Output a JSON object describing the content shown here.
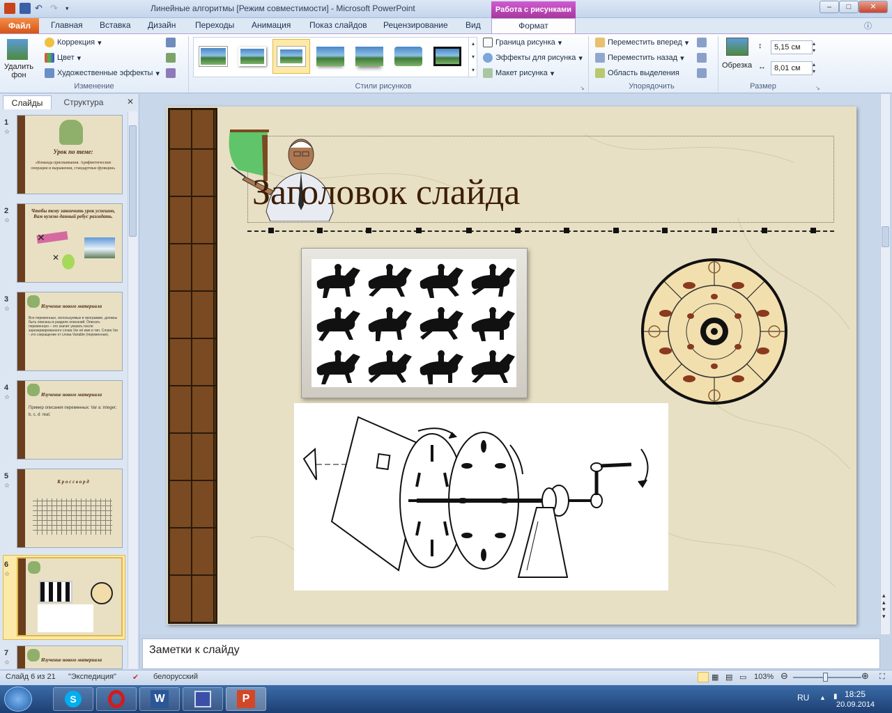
{
  "window": {
    "title": "Линейные алгоритмы [Режим совместимости]  -  Microsoft PowerPoint",
    "context_group": "Работа с рисунками",
    "controls": {
      "minimize": "–",
      "maximize": "□",
      "close": "✕"
    }
  },
  "tabs": {
    "file": "Файл",
    "items": [
      "Главная",
      "Вставка",
      "Дизайн",
      "Переходы",
      "Анимация",
      "Показ слайдов",
      "Рецензирование",
      "Вид"
    ],
    "active": "Формат"
  },
  "ribbon": {
    "remove_bg": {
      "line1": "Удалить",
      "line2": "фон"
    },
    "adjust": {
      "correction": "Коррекция",
      "color": "Цвет",
      "artistic": "Художественные эффекты",
      "label": "Изменение"
    },
    "styles": {
      "label": "Стили рисунков",
      "border": "Граница рисунка",
      "effects": "Эффекты для рисунка",
      "layout": "Макет рисунка"
    },
    "arrange": {
      "forward": "Переместить вперед",
      "backward": "Переместить назад",
      "selection": "Область выделения",
      "label": "Упорядочить"
    },
    "size": {
      "crop": "Обрезка",
      "height": "5,15 см",
      "width": "8,01 см",
      "label": "Размер"
    }
  },
  "left_panel": {
    "tab_slides": "Слайды",
    "tab_outline": "Структура",
    "close": "✕",
    "slides": [
      {
        "num": "1",
        "title": "Урок по теме:",
        "text": "«Команда присваивания. Арифметические операции и выражения, стандартные функции»"
      },
      {
        "num": "2",
        "title": "Чтобы тему закончить урок успешно, Вам нужно данный ребус разгадать.",
        "text": ""
      },
      {
        "num": "3",
        "title": "Изучение нового материала",
        "text": "Все переменные, используемые в программе, должны быть описаны в разделе описаний. Описать переменную – это значит указать после зарезервированного слова Var её имя и тип. Слово Var - это сокращение от слова Variable (переменная)."
      },
      {
        "num": "4",
        "title": "Изучение нового материала",
        "text": "Пример описания переменных: Var a: integer; b, c, d: real;"
      },
      {
        "num": "5",
        "title": "К р о с с в о р д",
        "text": ""
      },
      {
        "num": "6",
        "title": "",
        "text": ""
      },
      {
        "num": "7",
        "title": "Изучение нового материала",
        "text": ""
      }
    ]
  },
  "slide": {
    "title": "Заголовок слайда"
  },
  "notes": {
    "placeholder": "Заметки к слайду"
  },
  "status": {
    "slide_of": "Слайд 6 из 21",
    "theme": "\"Экспедиция\"",
    "language": "белорусский",
    "zoom": "103%"
  },
  "taskbar": {
    "lang": "RU",
    "time": "18:25",
    "date": "20.09.2014"
  },
  "colors": {
    "accent_file": "#d4541a",
    "context": "#a6379f",
    "slide_bg": "#e8e0c4",
    "title": "#3c1d06"
  }
}
